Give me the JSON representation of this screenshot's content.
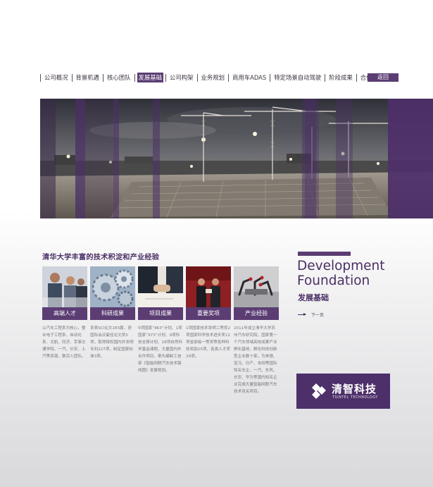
{
  "nav": {
    "items": [
      {
        "label": "公司概况",
        "active": false
      },
      {
        "label": "背景机遇",
        "active": false
      },
      {
        "label": "核心团队",
        "active": false
      },
      {
        "label": "发展基础",
        "active": true
      },
      {
        "label": "公司构架",
        "active": false
      },
      {
        "label": "业务规划",
        "active": false
      },
      {
        "label": "商用车ADAS",
        "active": false
      },
      {
        "label": "特定场景自动驾驶",
        "active": false
      },
      {
        "label": "阶段成果",
        "active": false
      },
      {
        "label": "合作伙伴",
        "active": false
      }
    ],
    "back_label": "返回"
  },
  "content": {
    "section_title": "清华大学丰富的技术积淀和产业经验",
    "cards": [
      {
        "label": "高端人才",
        "desc": "以汽车工程系为核心，整合电子工程系、自动化系、北航、同济、军事交通学院、一汽、长安、上汽等资源，数百人团队。",
        "icon": "team-photo"
      },
      {
        "label": "科研成果",
        "desc": "发表SCI论文283篇，获国际会议最佳论文奖5项，取得授权国内外发明专利227项，制定国家标准3项。",
        "icon": "gears-photo"
      },
      {
        "label": "项目成果",
        "desc": "5项国家“863”计划、1项国家“973”计划、9项科技支撑计划、18项自然科学基金课题，大量国内外合作项目。牵头编制工信部《智能网联汽车技术路线图》发展规划。",
        "icon": "handshake-photo"
      },
      {
        "label": "重要奖项",
        "desc": "1项国家技术发明二等奖2项国家科学技术进步奖12项省部级一等奖等各种科技奖励25项，各类人才奖29项。",
        "icon": "award-photo"
      },
      {
        "label": "产业经验",
        "desc": "2011年成立清华大学苏州汽车研究院，国家第一个汽车领域高校成果产业孵化基地，孵化科技创新型企业数十家。为奔驰、宝马、日产、本田等国际知名车企，一汽、东风、长安、华为等国内知名企业完成大量智能网联汽车技术攻关项目。",
        "icon": "robot-arms-photo"
      }
    ]
  },
  "side": {
    "title_en_line1": "Development",
    "title_en_line2": "Foundation",
    "title_cn": "发展基础",
    "next_label": "下一页",
    "logo_cn": "清智科技",
    "logo_en": "TSINTEL TECHNOLOGY"
  },
  "colors": {
    "accent": "#5b3d73",
    "dark_purple": "#4a2f64"
  }
}
